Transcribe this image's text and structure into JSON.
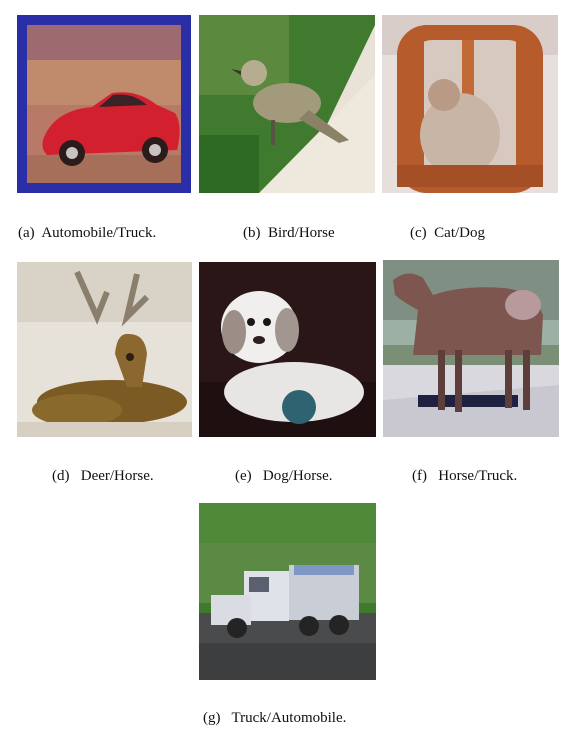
{
  "figure": {
    "panels": [
      {
        "letter": "(a)",
        "caption": "Automobile/Truck.",
        "subject": "red-car-image"
      },
      {
        "letter": "(b)",
        "caption": "Bird/Horse",
        "subject": "bird-image"
      },
      {
        "letter": "(c)",
        "caption": "Cat/Dog",
        "subject": "cat-image"
      },
      {
        "letter": "(d)",
        "caption": "Deer/Horse.",
        "subject": "deer-image"
      },
      {
        "letter": "(e)",
        "caption": "Dog/Horse.",
        "subject": "dog-image"
      },
      {
        "letter": "(f)",
        "caption": "Horse/Truck.",
        "subject": "horse-image"
      },
      {
        "letter": "(g)",
        "caption": "Truck/Automobile.",
        "subject": "truck-image"
      }
    ]
  }
}
